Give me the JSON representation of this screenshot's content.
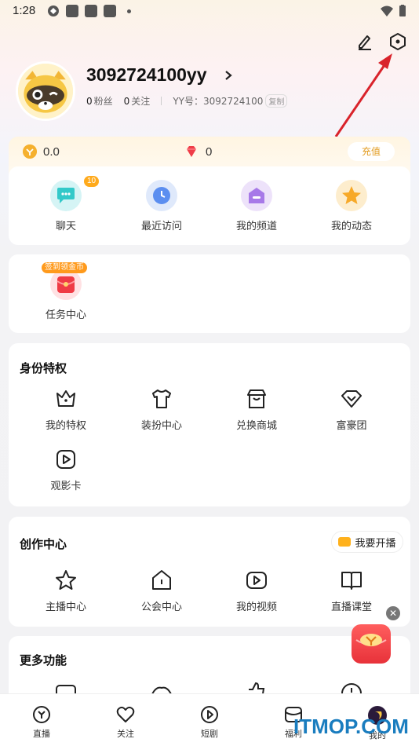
{
  "status_bar": {
    "time": "1:28"
  },
  "profile": {
    "username": "3092724100yy",
    "fans_count": "0",
    "fans_label": "粉丝",
    "follow_count": "0",
    "follow_label": "关注",
    "yy_id_label": "YY号：",
    "yy_id": "3092724100",
    "copy_label": "复制"
  },
  "wallet": {
    "coins": "0.0",
    "gems": "0",
    "recharge_label": "充值"
  },
  "quick_actions": [
    {
      "label": "聊天",
      "badge": "10"
    },
    {
      "label": "最近访问"
    },
    {
      "label": "我的频道"
    },
    {
      "label": "我的动态"
    }
  ],
  "tasks": {
    "badge": "签到领金币",
    "label": "任务中心"
  },
  "identity": {
    "title": "身份特权",
    "items": [
      {
        "label": "我的特权",
        "icon": "crown-icon"
      },
      {
        "label": "装扮中心",
        "icon": "shirt-icon"
      },
      {
        "label": "兑换商城",
        "icon": "shop-icon"
      },
      {
        "label": "富豪团",
        "icon": "diamond-icon"
      },
      {
        "label": "观影卡",
        "icon": "movie-card-icon"
      }
    ]
  },
  "creation": {
    "title": "创作中心",
    "live_button": "我要开播",
    "items": [
      {
        "label": "主播中心",
        "icon": "star-icon"
      },
      {
        "label": "公会中心",
        "icon": "guild-icon"
      },
      {
        "label": "我的视频",
        "icon": "video-icon"
      },
      {
        "label": "直播课堂",
        "icon": "book-icon"
      }
    ]
  },
  "more": {
    "title": "更多功能"
  },
  "bottom_nav": [
    {
      "label": "直播"
    },
    {
      "label": "关注"
    },
    {
      "label": "短剧"
    },
    {
      "label": "福利"
    },
    {
      "label": "我的"
    }
  ],
  "watermark": "ITMOP.COM",
  "colors": {
    "accent": "#ffaa1c",
    "annotation_arrow": "#d9232b"
  }
}
